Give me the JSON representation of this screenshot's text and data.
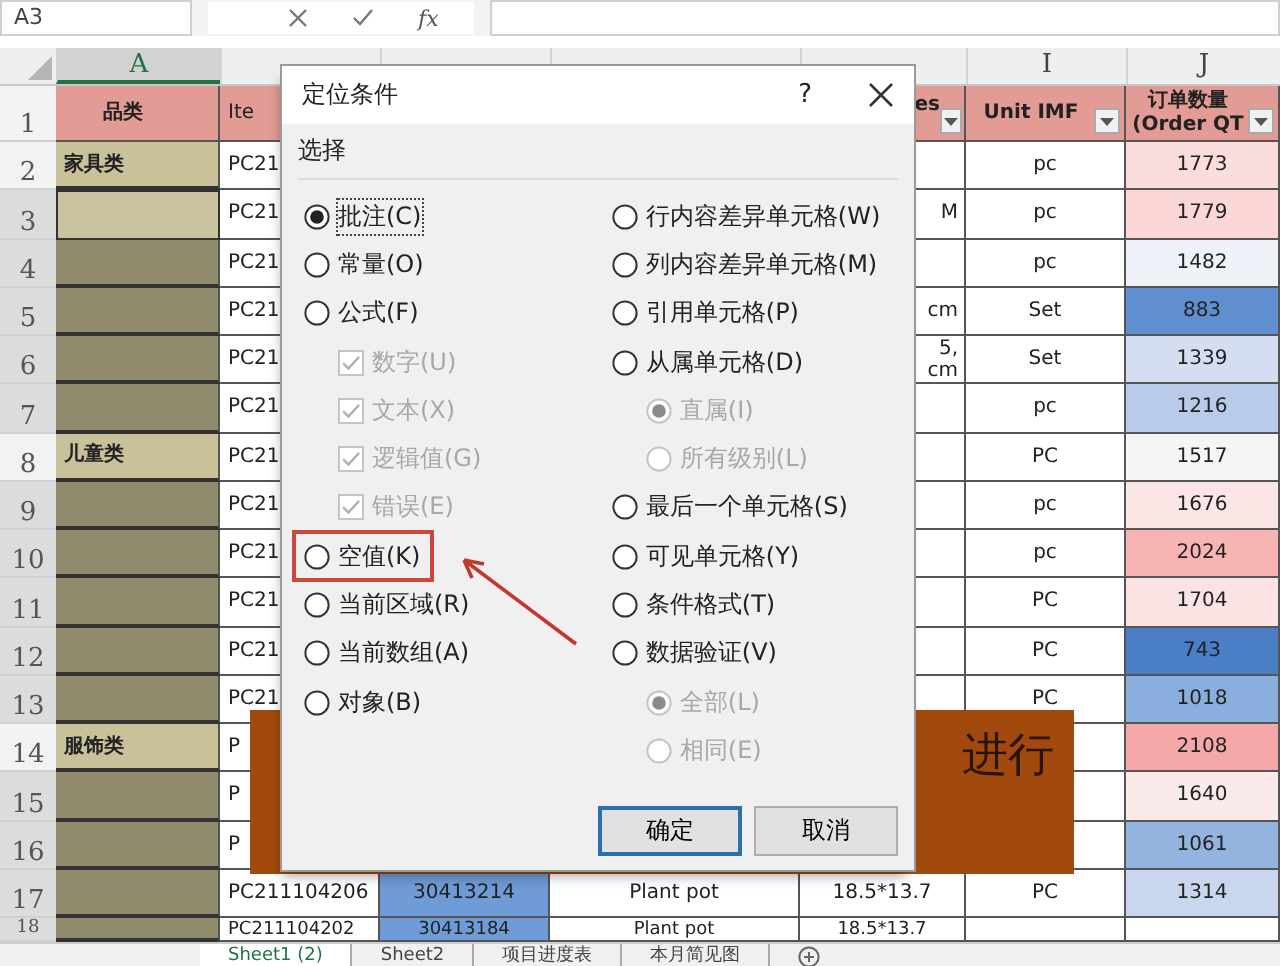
{
  "formula_bar": {
    "name_box": "A3",
    "fx_label": "fx"
  },
  "columns": [
    {
      "label": "A",
      "selected": true
    },
    {
      "selected": false
    },
    {
      "selected": false
    },
    {
      "selected": false
    },
    {
      "selected": false
    },
    {
      "label": "I",
      "selected": false
    },
    {
      "label": "J",
      "selected": false
    }
  ],
  "header_row": {
    "row": "1",
    "cells": [
      {
        "text": "品类"
      },
      {
        "text": "Ite"
      },
      {},
      {},
      {
        "text": "es",
        "filter": true
      },
      {
        "text": "Unit IMF",
        "filter": true
      },
      {
        "text": "订单数量\n(Order QT",
        "filter": true
      }
    ]
  },
  "rows": [
    {
      "row": "2",
      "selected": false,
      "cells": [
        {
          "text": "家具类",
          "color": "#c9c19a"
        },
        {
          "text": "PC21"
        },
        {},
        {},
        {},
        {
          "text": "pc"
        },
        {
          "text": "1773",
          "color": "#fbdcdc"
        }
      ]
    },
    {
      "row": "3",
      "selected": true,
      "active": true,
      "cells": [
        {
          "color": "#c9c49e"
        },
        {
          "text": "PC21"
        },
        {},
        {},
        {
          "text": "M"
        },
        {
          "text": "pc"
        },
        {
          "text": "1779",
          "color": "#fbd6d6"
        }
      ]
    },
    {
      "row": "4",
      "selected": true,
      "cells": [
        {
          "color": "#8f8a6c"
        },
        {
          "text": "PC21"
        },
        {},
        {},
        {},
        {
          "text": "pc"
        },
        {
          "text": "1482",
          "color": "#eef1f8"
        }
      ]
    },
    {
      "row": "5",
      "selected": true,
      "cells": [
        {
          "color": "#8f8a6c"
        },
        {
          "text": "PC21"
        },
        {},
        {},
        {
          "text": "cm"
        },
        {
          "text": "Set"
        },
        {
          "text": "883",
          "color": "#5f8fce"
        }
      ]
    },
    {
      "row": "6",
      "selected": true,
      "cells": [
        {
          "color": "#8f8a6c"
        },
        {
          "text": "PC21"
        },
        {},
        {},
        {
          "text": "5,\ncm"
        },
        {
          "text": "Set"
        },
        {
          "text": "1339",
          "color": "#d4def0"
        }
      ]
    },
    {
      "row": "7",
      "selected": true,
      "cells": [
        {
          "color": "#8f8a6c"
        },
        {
          "text": "PC21"
        },
        {},
        {},
        {},
        {
          "text": "pc"
        },
        {
          "text": "1216",
          "color": "#b9cbe8"
        }
      ]
    },
    {
      "row": "8",
      "selected": false,
      "cells": [
        {
          "text": "儿童类",
          "color": "#c9c19a"
        },
        {
          "text": "PC21"
        },
        {},
        {},
        {},
        {
          "text": "PC"
        },
        {
          "text": "1517",
          "color": "#f6f4f6"
        }
      ]
    },
    {
      "row": "9",
      "selected": true,
      "cells": [
        {
          "color": "#8f8a6c"
        },
        {
          "text": "PC21"
        },
        {},
        {},
        {},
        {
          "text": "pc"
        },
        {
          "text": "1676",
          "color": "#fbe6e6"
        }
      ]
    },
    {
      "row": "10",
      "selected": true,
      "cells": [
        {
          "color": "#8f8a6c"
        },
        {
          "text": "PC21"
        },
        {},
        {},
        {},
        {
          "text": "pc"
        },
        {
          "text": "2024",
          "color": "#f8b4b4"
        }
      ]
    },
    {
      "row": "11",
      "selected": true,
      "cells": [
        {
          "color": "#8f8a6c"
        },
        {
          "text": "PC21"
        },
        {},
        {},
        {},
        {
          "text": "PC"
        },
        {
          "text": "1704",
          "color": "#fbe3e3"
        }
      ]
    },
    {
      "row": "12",
      "selected": true,
      "cells": [
        {
          "color": "#8f8a6c"
        },
        {
          "text": "PC21"
        },
        {},
        {},
        {},
        {
          "text": "PC"
        },
        {
          "text": "743",
          "color": "#4a7fc6"
        }
      ]
    },
    {
      "row": "13",
      "selected": true,
      "cells": [
        {
          "color": "#8f8a6c"
        },
        {
          "text": "PC21"
        },
        {},
        {},
        {},
        {
          "text": "PC"
        },
        {
          "text": "1018",
          "color": "#8aaede"
        }
      ]
    },
    {
      "row": "14",
      "selected": false,
      "cells": [
        {
          "text": "服饰类",
          "color": "#c9c19a"
        },
        {
          "text": "P"
        },
        {},
        {},
        {},
        {},
        {
          "text": "2108",
          "color": "#f6a8a8"
        }
      ]
    },
    {
      "row": "15",
      "selected": true,
      "cells": [
        {
          "color": "#8f8a6c"
        },
        {
          "text": "P"
        },
        {},
        {},
        {},
        {},
        {
          "text": "1640",
          "color": "#fbeaea"
        }
      ]
    },
    {
      "row": "16",
      "selected": true,
      "cells": [
        {
          "color": "#8f8a6c"
        },
        {
          "text": "P"
        },
        {},
        {},
        {},
        {},
        {
          "text": "1061",
          "color": "#94b4e0"
        }
      ]
    },
    {
      "row": "17",
      "selected": true,
      "cells": [
        {
          "color": "#8f8a6c"
        },
        {
          "text": "PC211104206"
        },
        {
          "text": "30413214",
          "color": "#6f9bd6"
        },
        {
          "text": "Plant pot"
        },
        {
          "text": "18.5*13.7"
        },
        {
          "text": "PC"
        },
        {
          "text": "1314",
          "color": "#c9d7ee"
        }
      ]
    },
    {
      "row": "18",
      "selected": true,
      "cells": [
        {
          "color": "#8f8a6c"
        },
        {
          "text": "PC211104202"
        },
        {
          "text": "30413184",
          "color": "#6f9bd6"
        },
        {
          "text": "Plant pot"
        },
        {
          "text": "18.5*13.7"
        },
        {},
        {}
      ]
    }
  ],
  "sheet_tabs": [
    {
      "label": "Sheet1 (2)",
      "selected": true
    },
    {
      "label": "Sheet2",
      "selected": false
    },
    {
      "label": "项目进度表",
      "selected": false
    },
    {
      "label": "本月简见图",
      "selected": false
    }
  ],
  "banner": {
    "text": "进行"
  },
  "dialog": {
    "title": "定位条件",
    "help": "?",
    "group_label": "选择",
    "left": [
      {
        "kind": "radio",
        "label": "批注(C)",
        "selected": true,
        "focused": true
      },
      {
        "kind": "radio",
        "label": "常量(O)",
        "selected": false
      },
      {
        "kind": "radio",
        "label": "公式(F)",
        "selected": false,
        "children": [
          {
            "kind": "check",
            "label": "数字(U)",
            "checked": true,
            "disabled": true
          },
          {
            "kind": "check",
            "label": "文本(X)",
            "checked": true,
            "disabled": true
          },
          {
            "kind": "check",
            "label": "逻辑值(G)",
            "checked": true,
            "disabled": true
          },
          {
            "kind": "check",
            "label": "错误(E)",
            "checked": true,
            "disabled": true
          }
        ]
      },
      {
        "kind": "radio",
        "label": "空值(K)",
        "selected": false,
        "highlighted": true
      },
      {
        "kind": "radio",
        "label": "当前区域(R)",
        "selected": false
      },
      {
        "kind": "radio",
        "label": "当前数组(A)",
        "selected": false
      },
      {
        "kind": "radio",
        "label": "对象(B)",
        "selected": false
      }
    ],
    "right": [
      {
        "kind": "radio",
        "label": "行内容差异单元格(W)",
        "selected": false
      },
      {
        "kind": "radio",
        "label": "列内容差异单元格(M)",
        "selected": false
      },
      {
        "kind": "radio",
        "label": "引用单元格(P)",
        "selected": false
      },
      {
        "kind": "radio",
        "label": "从属单元格(D)",
        "selected": false,
        "children": [
          {
            "kind": "radio",
            "label": "直属(I)",
            "selected": true,
            "disabled": true
          },
          {
            "kind": "radio",
            "label": "所有级别(L)",
            "selected": false,
            "disabled": true
          }
        ]
      },
      {
        "kind": "radio",
        "label": "最后一个单元格(S)",
        "selected": false
      },
      {
        "kind": "radio",
        "label": "可见单元格(Y)",
        "selected": false
      },
      {
        "kind": "radio",
        "label": "条件格式(T)",
        "selected": false
      },
      {
        "kind": "radio",
        "label": "数据验证(V)",
        "selected": false,
        "children": [
          {
            "kind": "radio",
            "label": "全部(L)",
            "selected": true,
            "disabled": true
          },
          {
            "kind": "radio",
            "label": "相同(E)",
            "selected": false,
            "disabled": true
          }
        ]
      }
    ],
    "buttons": [
      {
        "label": "确定",
        "default": true
      },
      {
        "label": "取消",
        "default": false
      }
    ]
  }
}
